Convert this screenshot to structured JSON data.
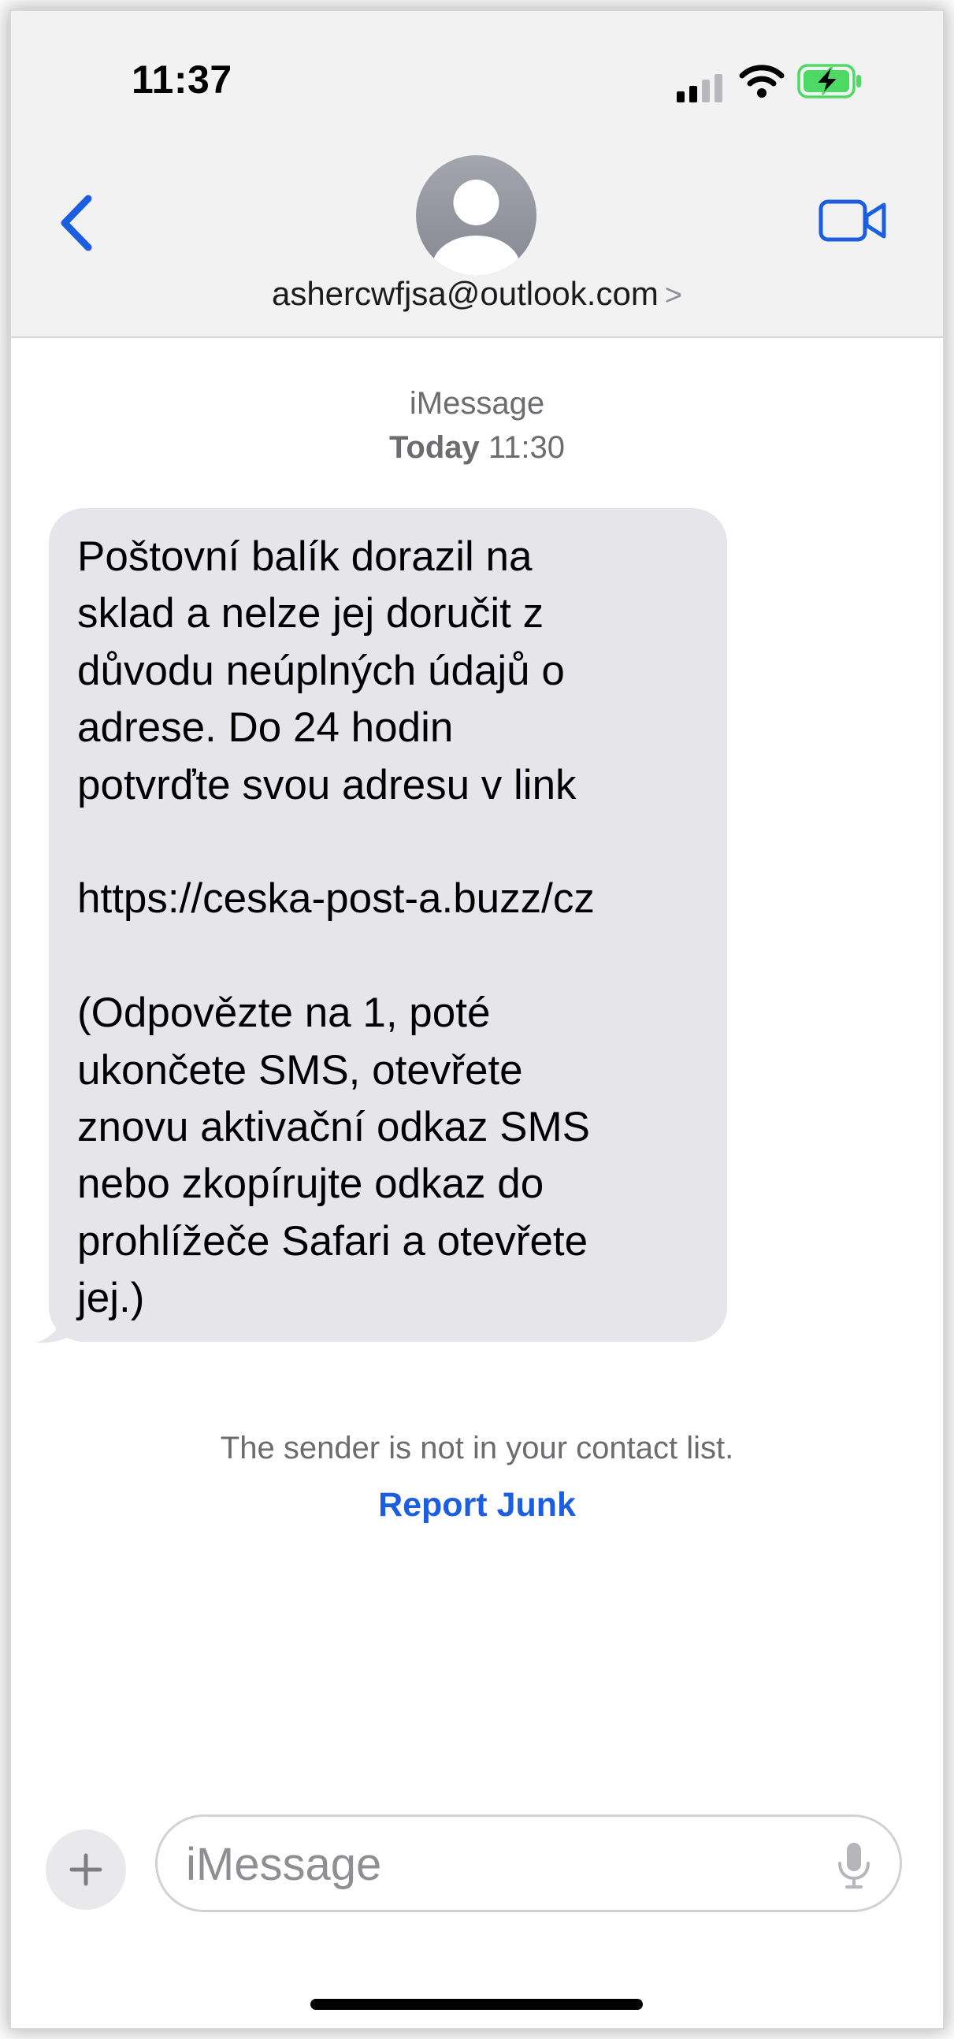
{
  "status_bar": {
    "time": "11:37",
    "icons": [
      "signal-icon",
      "wifi-icon",
      "battery-charging-icon"
    ],
    "battery_color": "#4cd964"
  },
  "nav": {
    "back_icon": "chevron-left-icon",
    "avatar_icon": "person-avatar-icon",
    "contact": "ashercwfjsa@outlook.com",
    "contact_chevron": ">",
    "video_icon": "video-camera-icon",
    "accent_color": "#1b5fe0"
  },
  "conversation": {
    "service": "iMessage",
    "day": "Today",
    "time": "11:30",
    "message": "Poštovní balík dorazil na\nsklad a nelze jej doručit z\ndůvodu neúplných údajů o\nadrese. Do 24 hodin\npotvrďte svou adresu v link\n\nhttps://ceska-post-a.buzz/cz\n\n(Odpovězte na 1, poté\nukončete SMS, otevřete\nznovu aktivační odkaz SMS\nnebo zkopírujte odkaz do\nprohlížeče Safari a otevřete\njej.)",
    "notice": "The sender is not in your contact list.",
    "report_label": "Report Junk"
  },
  "composer": {
    "plus_icon": "plus-icon",
    "placeholder": "iMessage",
    "mic_icon": "microphone-icon"
  }
}
